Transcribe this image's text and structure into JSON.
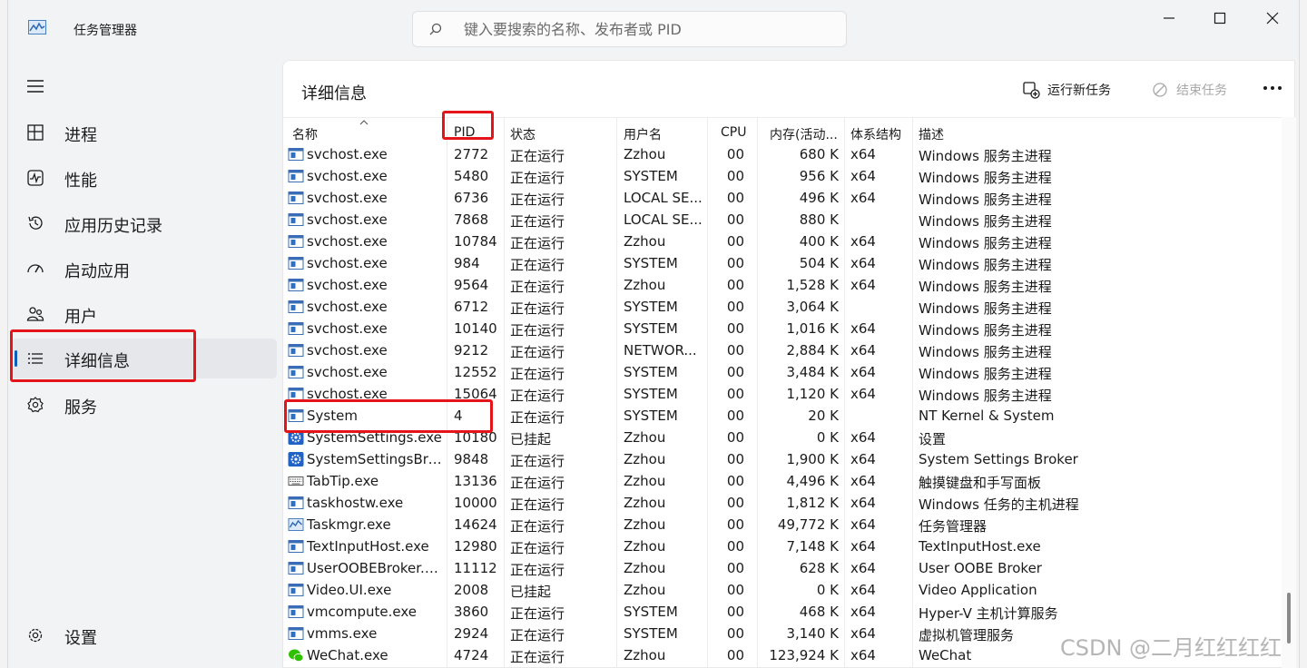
{
  "window": {
    "title": "任务管理器",
    "search_placeholder": "键入要搜索的名称、发布者或 PID"
  },
  "sidebar": {
    "items": [
      {
        "label": "进程",
        "icon": "processes-icon"
      },
      {
        "label": "性能",
        "icon": "performance-icon"
      },
      {
        "label": "应用历史记录",
        "icon": "app-history-icon"
      },
      {
        "label": "启动应用",
        "icon": "startup-apps-icon"
      },
      {
        "label": "用户",
        "icon": "users-icon"
      },
      {
        "label": "详细信息",
        "icon": "details-icon",
        "active": true
      },
      {
        "label": "服务",
        "icon": "services-icon"
      }
    ],
    "settings_label": "设置"
  },
  "main": {
    "title": "详细信息",
    "run_new_task": "运行新任务",
    "end_task": "结束任务"
  },
  "table": {
    "columns": {
      "name": "名称",
      "pid": "PID",
      "status": "状态",
      "user": "用户名",
      "cpu": "CPU",
      "memory": "内存(活动...",
      "arch": "体系结构",
      "desc": "描述"
    },
    "rows": [
      {
        "icon": "service-host-icon",
        "name": "svchost.exe",
        "pid": "2772",
        "status": "正在运行",
        "user": "Zzhou",
        "cpu": "00",
        "mem": "680 K",
        "arch": "x64",
        "desc": "Windows 服务主进程"
      },
      {
        "icon": "service-host-icon",
        "name": "svchost.exe",
        "pid": "5480",
        "status": "正在运行",
        "user": "SYSTEM",
        "cpu": "00",
        "mem": "956 K",
        "arch": "x64",
        "desc": "Windows 服务主进程"
      },
      {
        "icon": "service-host-icon",
        "name": "svchost.exe",
        "pid": "6736",
        "status": "正在运行",
        "user": "LOCAL SE...",
        "cpu": "00",
        "mem": "496 K",
        "arch": "x64",
        "desc": "Windows 服务主进程"
      },
      {
        "icon": "service-host-icon",
        "name": "svchost.exe",
        "pid": "7868",
        "status": "正在运行",
        "user": "LOCAL SE...",
        "cpu": "00",
        "mem": "880 K",
        "arch": "",
        "desc": "Windows 服务主进程"
      },
      {
        "icon": "service-host-icon",
        "name": "svchost.exe",
        "pid": "10784",
        "status": "正在运行",
        "user": "Zzhou",
        "cpu": "00",
        "mem": "400 K",
        "arch": "x64",
        "desc": "Windows 服务主进程"
      },
      {
        "icon": "service-host-icon",
        "name": "svchost.exe",
        "pid": "984",
        "status": "正在运行",
        "user": "SYSTEM",
        "cpu": "00",
        "mem": "504 K",
        "arch": "x64",
        "desc": "Windows 服务主进程"
      },
      {
        "icon": "service-host-icon",
        "name": "svchost.exe",
        "pid": "9564",
        "status": "正在运行",
        "user": "Zzhou",
        "cpu": "00",
        "mem": "1,528 K",
        "arch": "x64",
        "desc": "Windows 服务主进程"
      },
      {
        "icon": "service-host-icon",
        "name": "svchost.exe",
        "pid": "6712",
        "status": "正在运行",
        "user": "SYSTEM",
        "cpu": "00",
        "mem": "3,064 K",
        "arch": "",
        "desc": "Windows 服务主进程"
      },
      {
        "icon": "service-host-icon",
        "name": "svchost.exe",
        "pid": "10140",
        "status": "正在运行",
        "user": "SYSTEM",
        "cpu": "00",
        "mem": "1,016 K",
        "arch": "x64",
        "desc": "Windows 服务主进程"
      },
      {
        "icon": "service-host-icon",
        "name": "svchost.exe",
        "pid": "9212",
        "status": "正在运行",
        "user": "NETWOR...",
        "cpu": "00",
        "mem": "2,884 K",
        "arch": "x64",
        "desc": "Windows 服务主进程"
      },
      {
        "icon": "service-host-icon",
        "name": "svchost.exe",
        "pid": "12552",
        "status": "正在运行",
        "user": "SYSTEM",
        "cpu": "00",
        "mem": "3,484 K",
        "arch": "x64",
        "desc": "Windows 服务主进程"
      },
      {
        "icon": "service-host-icon",
        "name": "svchost.exe",
        "pid": "15064",
        "status": "正在运行",
        "user": "SYSTEM",
        "cpu": "00",
        "mem": "1,120 K",
        "arch": "x64",
        "desc": "Windows 服务主进程"
      },
      {
        "icon": "window-app-icon",
        "name": "System",
        "pid": "4",
        "status": "正在运行",
        "user": "SYSTEM",
        "cpu": "00",
        "mem": "20 K",
        "arch": "",
        "desc": "NT Kernel & System"
      },
      {
        "icon": "gear-app-icon",
        "name": "SystemSettings.exe",
        "pid": "10180",
        "status": "已挂起",
        "user": "Zzhou",
        "cpu": "00",
        "mem": "0 K",
        "arch": "x64",
        "desc": "设置"
      },
      {
        "icon": "gear-app-icon",
        "name": "SystemSettingsBro...",
        "pid": "9848",
        "status": "正在运行",
        "user": "Zzhou",
        "cpu": "00",
        "mem": "1,900 K",
        "arch": "x64",
        "desc": "System Settings Broker"
      },
      {
        "icon": "keyboard-icon",
        "name": "TabTip.exe",
        "pid": "13136",
        "status": "正在运行",
        "user": "Zzhou",
        "cpu": "00",
        "mem": "4,496 K",
        "arch": "x64",
        "desc": "触摸键盘和手写面板"
      },
      {
        "icon": "window-app-icon",
        "name": "taskhostw.exe",
        "pid": "10000",
        "status": "正在运行",
        "user": "Zzhou",
        "cpu": "00",
        "mem": "1,812 K",
        "arch": "x64",
        "desc": "Windows 任务的主机进程"
      },
      {
        "icon": "task-manager-icon",
        "name": "Taskmgr.exe",
        "pid": "14624",
        "status": "正在运行",
        "user": "Zzhou",
        "cpu": "00",
        "mem": "49,772 K",
        "arch": "x64",
        "desc": "任务管理器"
      },
      {
        "icon": "window-app-icon",
        "name": "TextInputHost.exe",
        "pid": "12980",
        "status": "正在运行",
        "user": "Zzhou",
        "cpu": "00",
        "mem": "7,148 K",
        "arch": "x64",
        "desc": "TextInputHost.exe"
      },
      {
        "icon": "window-app-icon",
        "name": "UserOOBEBroker.e...",
        "pid": "11112",
        "status": "正在运行",
        "user": "Zzhou",
        "cpu": "00",
        "mem": "628 K",
        "arch": "x64",
        "desc": "User OOBE Broker"
      },
      {
        "icon": "window-app-icon",
        "name": "Video.UI.exe",
        "pid": "2008",
        "status": "已挂起",
        "user": "Zzhou",
        "cpu": "00",
        "mem": "0 K",
        "arch": "x64",
        "desc": "Video Application"
      },
      {
        "icon": "window-app-icon",
        "name": "vmcompute.exe",
        "pid": "3860",
        "status": "正在运行",
        "user": "SYSTEM",
        "cpu": "00",
        "mem": "468 K",
        "arch": "x64",
        "desc": "Hyper-V 主机计算服务"
      },
      {
        "icon": "window-app-icon",
        "name": "vmms.exe",
        "pid": "2924",
        "status": "正在运行",
        "user": "SYSTEM",
        "cpu": "00",
        "mem": "3,140 K",
        "arch": "x64",
        "desc": "虚拟机管理服务"
      },
      {
        "icon": "wechat-icon",
        "name": "WeChat.exe",
        "pid": "4724",
        "status": "正在运行",
        "user": "Zzhou",
        "cpu": "00",
        "mem": "123,924 K",
        "arch": "x64",
        "desc": "WeChat"
      }
    ]
  },
  "watermark": "CSDN @二月红红红红",
  "colors": {
    "accent": "#0a5fbd",
    "highlight_box": "#e5141b",
    "active_nav_bg": "#e6e7ea"
  }
}
